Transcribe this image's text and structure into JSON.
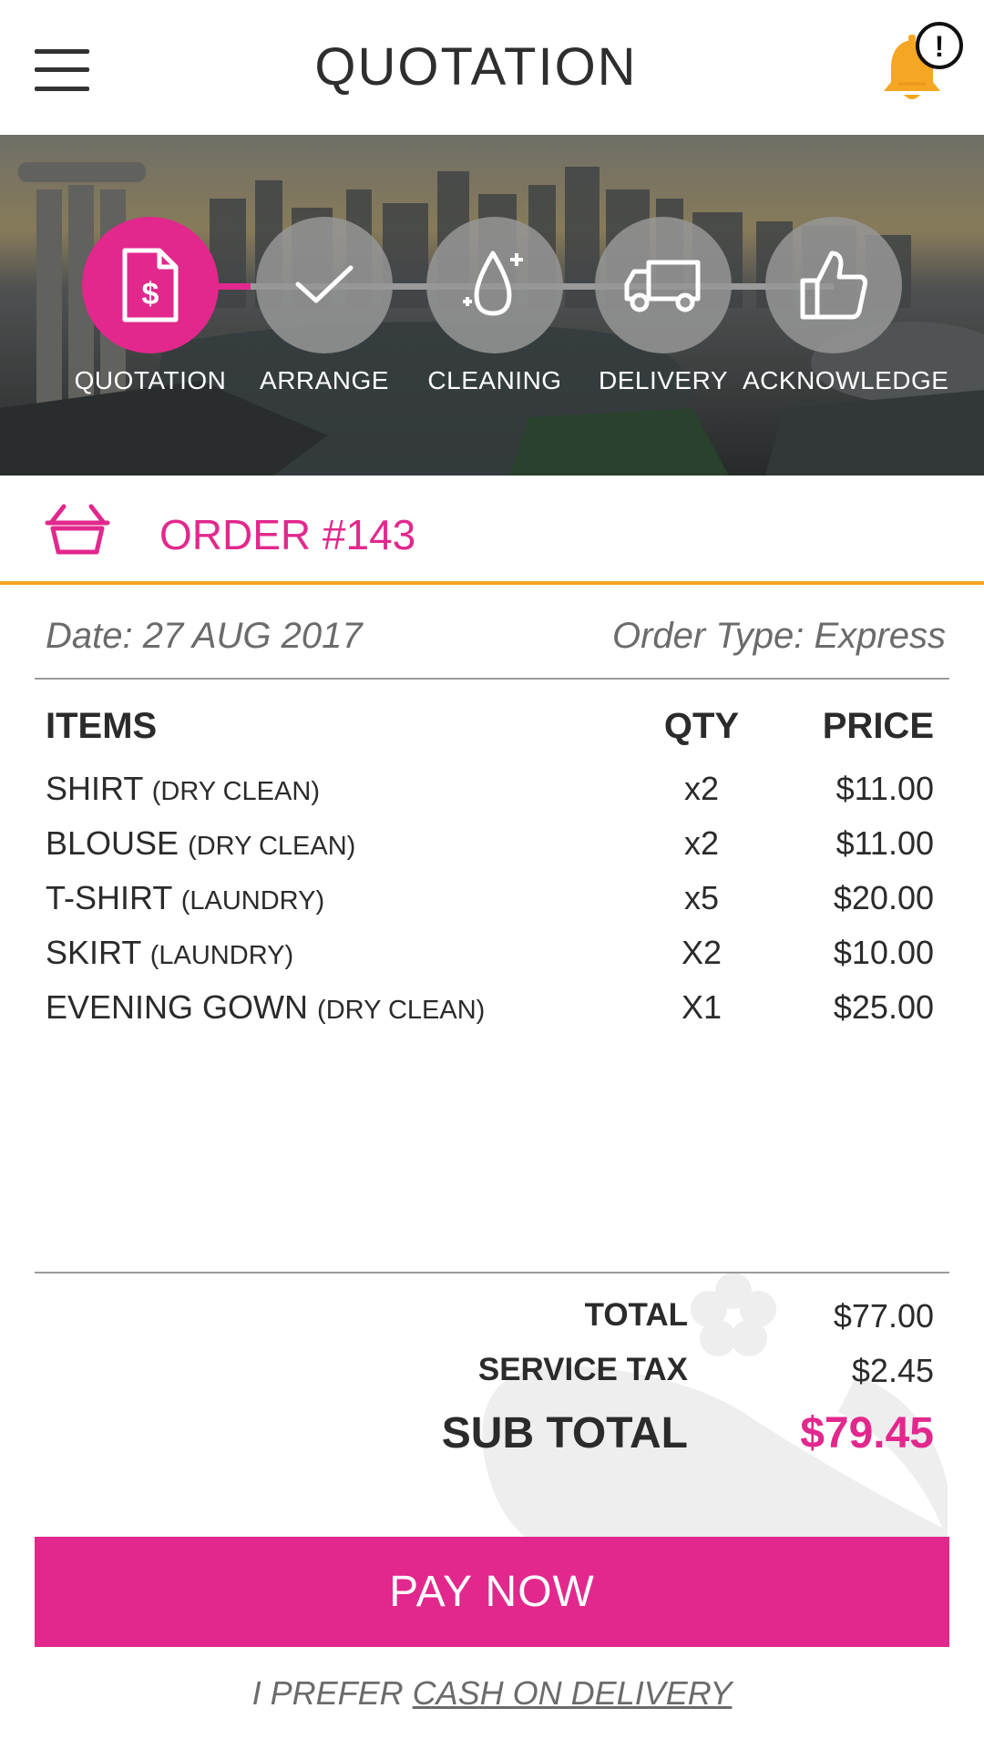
{
  "header": {
    "title": "QUOTATION",
    "notification_badge": "!",
    "accent_color": "#f5a623"
  },
  "steps": [
    {
      "label": "QUOTATION",
      "icon": "document-dollar-icon",
      "active": true
    },
    {
      "label": "ARRANGE",
      "icon": "check-icon",
      "active": false
    },
    {
      "label": "CLEANING",
      "icon": "water-drop-icon",
      "active": false
    },
    {
      "label": "DELIVERY",
      "icon": "truck-icon",
      "active": false
    },
    {
      "label": "ACKNOWLEDGE",
      "icon": "thumbs-up-icon",
      "active": false
    }
  ],
  "order": {
    "title": "ORDER #143",
    "date": "Date: 27 AUG 2017",
    "type": "Order Type: Express"
  },
  "table": {
    "headers": {
      "items": "ITEMS",
      "qty": "QTY",
      "price": "PRICE"
    },
    "rows": [
      {
        "name": "SHIRT",
        "service": "(DRY CLEAN)",
        "qty": "x2",
        "price": "$11.00"
      },
      {
        "name": "BLOUSE",
        "service": "(DRY CLEAN)",
        "qty": "x2",
        "price": "$11.00"
      },
      {
        "name": "T-SHIRT",
        "service": "(LAUNDRY)",
        "qty": "x5",
        "price": "$20.00"
      },
      {
        "name": "SKIRT",
        "service": "(LAUNDRY)",
        "qty": "X2",
        "price": "$10.00"
      },
      {
        "name": "EVENING GOWN",
        "service": "(DRY CLEAN)",
        "qty": "X1",
        "price": "$25.00"
      }
    ]
  },
  "totals": {
    "total_label": "TOTAL",
    "total_value": "$77.00",
    "tax_label": "SERVICE TAX",
    "tax_value": "$2.45",
    "subtotal_label": "SUB TOTAL",
    "subtotal_value": "$79.45"
  },
  "actions": {
    "pay_label": "PAY NOW",
    "cash_prefix": "I PREFER",
    "cash_link": "CASH ON DELIVERY"
  },
  "colors": {
    "brand": "#e2288d",
    "accent": "#f5a623",
    "step_inactive": "#969696"
  }
}
